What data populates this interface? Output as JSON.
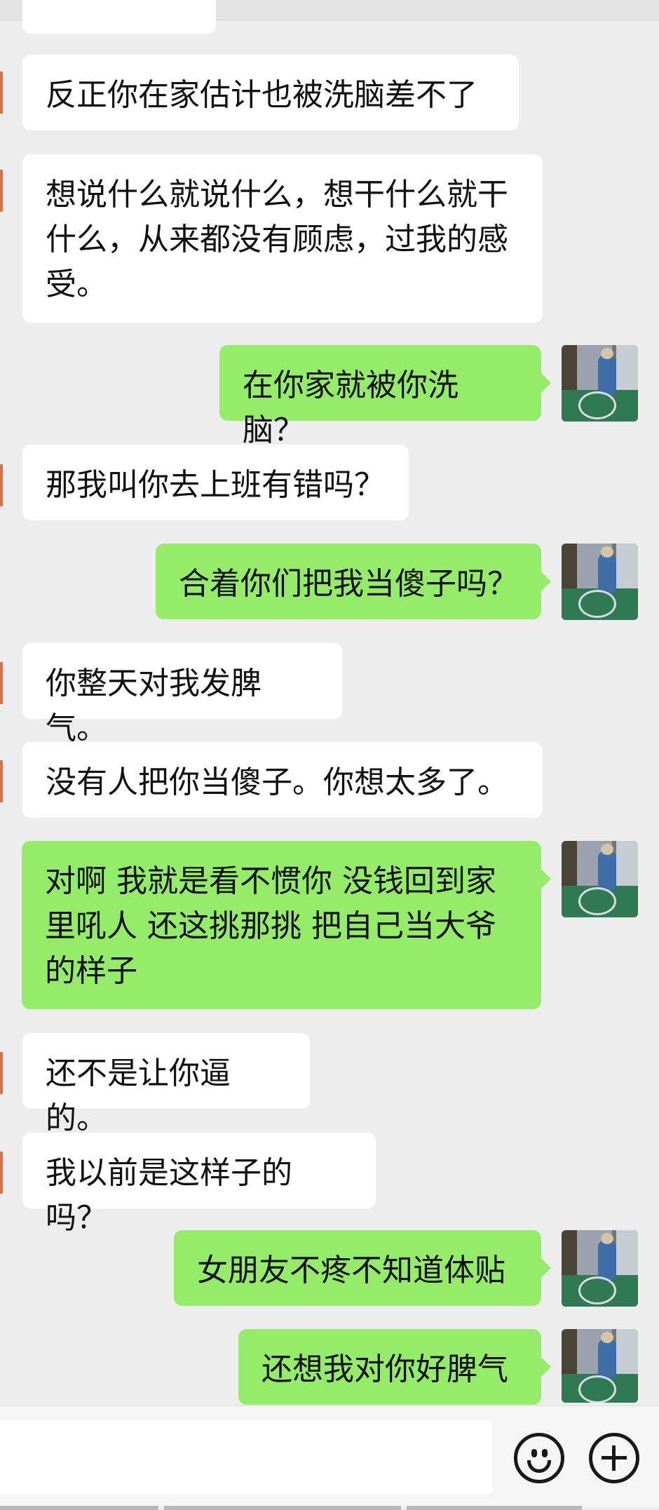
{
  "conversation": {
    "messages": [
      {
        "side": "in",
        "text": "反正你在家估计也被洗脑差不了"
      },
      {
        "side": "in",
        "text": "想说什么就说什么，想干什么就干什么，从来都没有顾虑，过我的感受。"
      },
      {
        "side": "out",
        "text": "在你家就被你洗脑？"
      },
      {
        "side": "in",
        "text": "那我叫你去上班有错吗？"
      },
      {
        "side": "out",
        "text": "合着你们把我当傻子吗？"
      },
      {
        "side": "in",
        "text": "你整天对我发脾气。"
      },
      {
        "side": "in",
        "text": "没有人把你当傻子。你想太多了。"
      },
      {
        "side": "out",
        "text": "对啊  我就是看不惯你 没钱回到家里吼人   还这挑那挑  把自己当大爷的样子"
      },
      {
        "side": "in",
        "text": "还不是让你逼的。"
      },
      {
        "side": "in",
        "text": "我以前是这样子的吗？"
      },
      {
        "side": "out",
        "text": "女朋友不疼不知道体贴"
      },
      {
        "side": "out",
        "text": "还想我对你好脾气"
      }
    ]
  },
  "footer": {
    "emoji_icon": "emoji-smile-icon",
    "plus_icon": "plus-circle-icon"
  },
  "colors": {
    "background": "#ededed",
    "incoming_bubble": "#ffffff",
    "outgoing_bubble": "#95ec69"
  }
}
